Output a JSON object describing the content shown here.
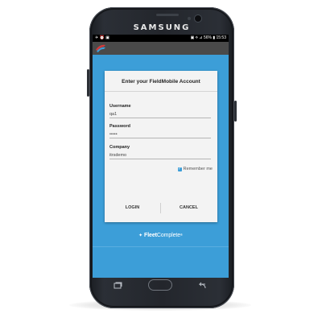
{
  "phone": {
    "brand": "SAMSUNG"
  },
  "status_bar": {
    "left": "✈ ⏰ ▣",
    "right": "▣ ⟡ ⊿ 56% ▮ 15:53"
  },
  "dialog": {
    "title": "Enter your FieldMobile Account",
    "username": {
      "label": "Username",
      "value": "qa1"
    },
    "password": {
      "label": "Password",
      "value": "•••••"
    },
    "company": {
      "label": "Company",
      "value": "itrsdemo"
    },
    "remember_me": {
      "label": "Remember me",
      "checked": true
    },
    "login_label": "LOGIN",
    "cancel_label": "CANCEL"
  },
  "footer": {
    "brand_part1": "Fleet",
    "brand_part2": "Complete",
    "trademark": "®"
  },
  "nav": {
    "recent_icon": "recent-apps-icon",
    "home_icon": "home-button-icon",
    "back_icon": "back-arrow-icon"
  },
  "colors": {
    "screen_bg": "#3c9ed8",
    "appbar_bg": "#4a4a4a",
    "dialog_bg": "#f3f3f3"
  }
}
